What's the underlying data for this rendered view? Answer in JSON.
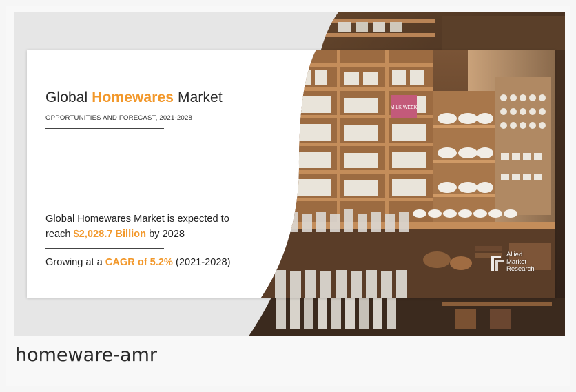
{
  "banner": {
    "title_prefix": "Global ",
    "title_highlight": "Homewares",
    "title_suffix": " Market",
    "subtitle": "OPPORTUNITIES AND FORECAST, 2021-2028",
    "desc_line1": "Global Homewares Market is expected to",
    "desc_reach": "reach ",
    "desc_value": "$2,028.7 Billion",
    "desc_by": " by 2028",
    "growth_prefix": "Growing at a ",
    "growth_highlight": "CAGR of 5.2%",
    "growth_suffix": " (2021-2028)",
    "logo_line1": "Allied",
    "logo_line2": "Market",
    "logo_line3": "Research",
    "sign_text": "MILK WEEK"
  },
  "caption": "homeware-amr",
  "colors": {
    "accent": "#f2982b",
    "wood": "#a87446",
    "background": "#e6e6e6"
  }
}
